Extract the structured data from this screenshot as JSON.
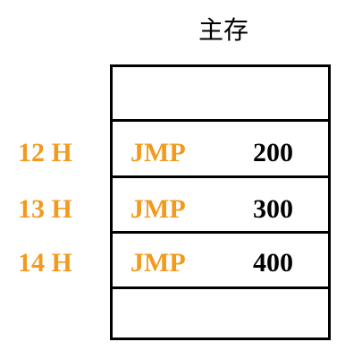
{
  "title": "主存",
  "rows": [
    {
      "address": "12 H",
      "opcode": "JMP",
      "operand": "200"
    },
    {
      "address": "13 H",
      "opcode": "JMP",
      "operand": "300"
    },
    {
      "address": "14 H",
      "opcode": "JMP",
      "operand": "400"
    }
  ],
  "colors": {
    "highlight": "#F39A1E",
    "text": "#000000",
    "line": "#000000"
  }
}
